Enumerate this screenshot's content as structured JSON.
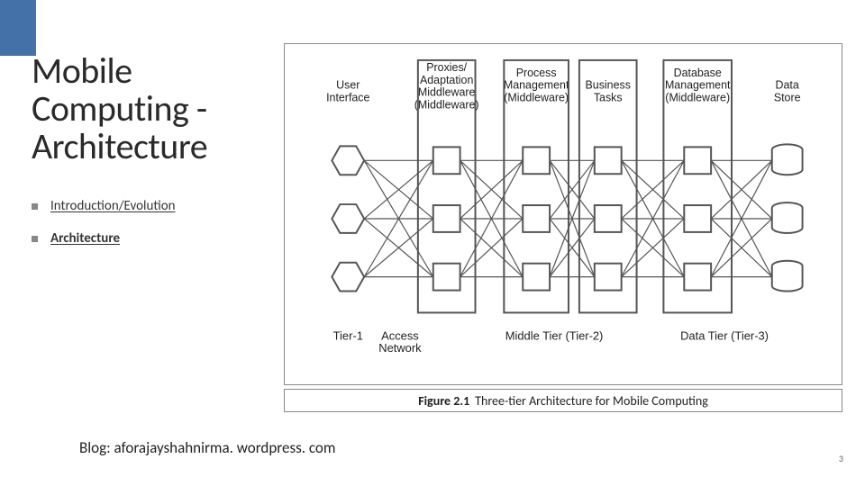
{
  "title": "Mobile Computing - Architecture",
  "bullets": [
    {
      "text": "Introduction/Evolution",
      "underline": true,
      "bold": false
    },
    {
      "text": "Architecture",
      "underline": true,
      "bold": true
    }
  ],
  "footer": "Blog: aforajayshahnirma. wordpress. com",
  "page_number": "3",
  "figure": {
    "caption_label": "Figure 2.1",
    "caption_text": "Three-tier Architecture for Mobile Computing",
    "columns": [
      {
        "key": "ui",
        "lines": [
          "User",
          "Interface"
        ]
      },
      {
        "key": "prox",
        "lines": [
          "Proxies/",
          "Adaptation",
          "Middleware",
          "(Middleware)"
        ]
      },
      {
        "key": "pm",
        "lines": [
          "Process",
          "Management",
          "(Middleware)"
        ]
      },
      {
        "key": "bt",
        "lines": [
          "Business",
          "Tasks"
        ]
      },
      {
        "key": "dbm",
        "lines": [
          "Database",
          "Management",
          "(Middleware)"
        ]
      },
      {
        "key": "ds",
        "lines": [
          "Data",
          "Store"
        ]
      }
    ],
    "tier_labels": {
      "tier1": "Tier-1",
      "access": [
        "Access",
        "Network"
      ],
      "tier2": "Middle Tier (Tier-2)",
      "tier3": "Data Tier (Tier-3)"
    }
  }
}
